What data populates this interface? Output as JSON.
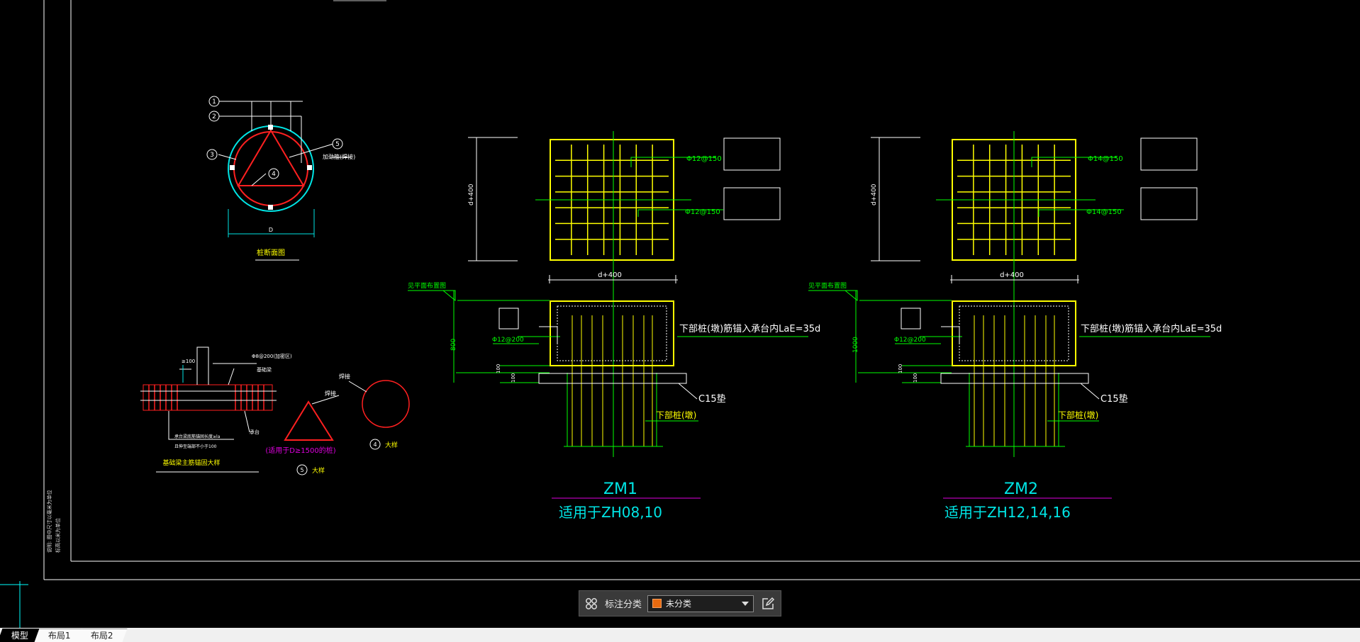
{
  "drawing": {
    "pile_section_title": "桩断面图",
    "pile_callouts": [
      "1",
      "2",
      "3",
      "4",
      "5"
    ],
    "pile_note_right": "加劲箍(焊接)",
    "pile_dim": "D",
    "beam_detail_title": "基础梁主筋锚固大样",
    "beam_labels": [
      "Φ8@200(加密区)",
      "基础梁",
      "承台"
    ],
    "beam_notes": [
      "承台梁底筋锚固长度≥la",
      "且伸至端部不小于100"
    ],
    "beam_dim": "≥100",
    "triangle_label": "焊接",
    "triangle_note": "(适用于D≥1500的桩)",
    "triangle_detail": "大样",
    "triangle_callout": "5",
    "circle_label": "焊接",
    "circle_detail": "大样",
    "circle_callout": "4",
    "zm1": {
      "title": "ZM1",
      "subtitle": "适用于ZH08,10",
      "rebar_top": "Φ12@150",
      "rebar_bottom": "Φ12@150",
      "vdim": "d+400",
      "hdim": "d+400",
      "side_rebar": "Φ12@200",
      "height": "800",
      "ref_note": "见平面布置图",
      "anchor_note": "下部桩(墩)筋锚入承台内LaE=35d",
      "concrete": "C15垫",
      "pile_label": "下部桩(墩)",
      "small_dims": [
        "100",
        "100"
      ]
    },
    "zm2": {
      "title": "ZM2",
      "subtitle": "适用于ZH12,14,16",
      "rebar_top": "Φ14@150",
      "rebar_bottom": "Φ14@150",
      "vdim": "d+400",
      "hdim": "d+400",
      "side_rebar": "Φ12@200",
      "height": "1000",
      "ref_note": "见平面布置图",
      "anchor_note": "下部桩(墩)筋锚入承台内LaE=35d",
      "concrete": "C15垫",
      "pile_label": "下部桩(墩)",
      "small_dims": [
        "100",
        "100"
      ]
    },
    "left_margin_notes": [
      "说明: 图中尺寸以毫米为单位",
      "标高以米为单位"
    ]
  },
  "annotation_bar": {
    "label": "标注分类",
    "selected": "未分类",
    "swatch_color": "#e86a10"
  },
  "tabs": [
    {
      "label": "模型",
      "active": true
    },
    {
      "label": "布局1",
      "active": false
    },
    {
      "label": "布局2",
      "active": false
    }
  ],
  "colors": {
    "frame": "#ffffff",
    "rebar_grid": "#ffff00",
    "leader": "#00ff00",
    "cyan": "#00e5e5",
    "red": "#ff2020",
    "magenta": "#e000e0"
  }
}
